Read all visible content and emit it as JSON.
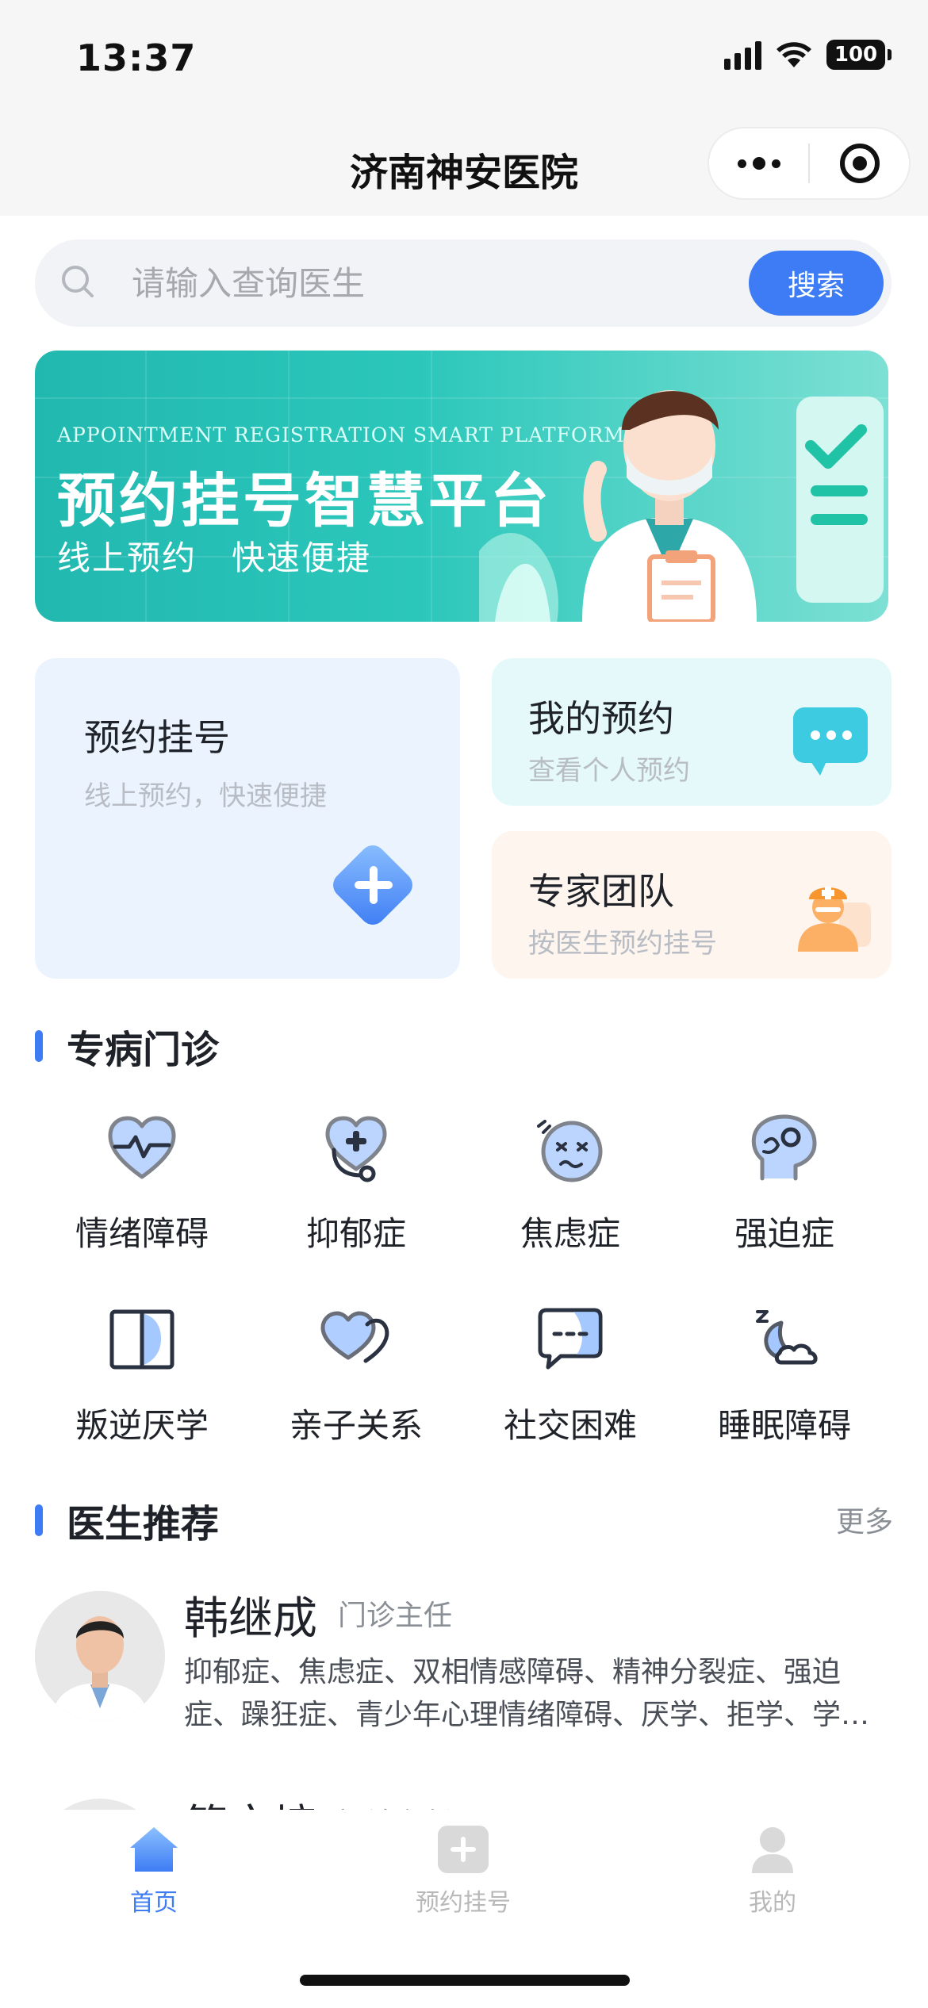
{
  "status_bar": {
    "time": "13:37",
    "battery": "100"
  },
  "nav": {
    "title": "济南神安医院"
  },
  "search": {
    "placeholder": "请输入查询医生",
    "button_label": "搜索"
  },
  "banner": {
    "english": "APPOINTMENT REGISTRATION SMART PLATFORM",
    "title": "预约挂号智慧平台",
    "subtitle": "线上预约　快速便捷"
  },
  "cards": {
    "register": {
      "title": "预约挂号",
      "subtitle": "线上预约，快速便捷"
    },
    "my_appointments": {
      "title": "我的预约",
      "subtitle": "查看个人预约"
    },
    "expert_team": {
      "title": "专家团队",
      "subtitle": "按医生预约挂号"
    }
  },
  "specialty": {
    "title": "专病门诊",
    "items": [
      {
        "label": "情绪障碍",
        "icon": "heart-pulse-icon"
      },
      {
        "label": "抑郁症",
        "icon": "stethoscope-heart-icon"
      },
      {
        "label": "焦虑症",
        "icon": "anxious-face-icon"
      },
      {
        "label": "强迫症",
        "icon": "head-brain-icon"
      },
      {
        "label": "叛逆厌学",
        "icon": "book-icon"
      },
      {
        "label": "亲子关系",
        "icon": "two-hearts-icon"
      },
      {
        "label": "社交困难",
        "icon": "chat-bubble-icon"
      },
      {
        "label": "睡眠障碍",
        "icon": "moon-cloud-icon"
      }
    ]
  },
  "doctors": {
    "title": "医生推荐",
    "more": "更多",
    "list": [
      {
        "name": "韩继成",
        "title": "门诊主任",
        "line1": "抑郁症、焦虑症、双相情感障碍、精神分裂症、强迫",
        "line2": "症、躁狂症、青少年心理情绪障碍、厌学、拒学、学…"
      },
      {
        "name": "简文培",
        "title": "门诊主任"
      }
    ]
  },
  "tabbar": {
    "items": [
      {
        "label": "首页",
        "active": true
      },
      {
        "label": "预约挂号",
        "active": false
      },
      {
        "label": "我的",
        "active": false
      }
    ]
  },
  "colors": {
    "accent": "#3d7cf4",
    "banner": "#2cc7bb"
  }
}
